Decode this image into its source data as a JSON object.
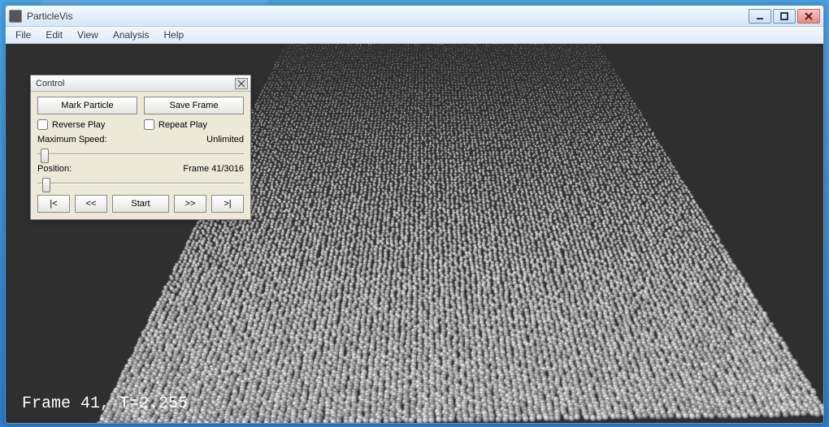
{
  "window": {
    "title": "ParticleVis"
  },
  "menu": {
    "items": [
      "File",
      "Edit",
      "View",
      "Analysis",
      "Help"
    ]
  },
  "viewport": {
    "frame_label": "Frame 41, T=2.255"
  },
  "control": {
    "title": "Control",
    "mark_particle": "Mark Particle",
    "save_frame": "Save Frame",
    "reverse_play": "Reverse Play",
    "repeat_play": "Repeat Play",
    "max_speed_label": "Maximum Speed:",
    "max_speed_value": "Unlimited",
    "position_label": "Position:",
    "position_value": "Frame 41/3016",
    "first": "|<",
    "prev": "<<",
    "start": "Start",
    "next": ">>",
    "last": ">|"
  }
}
